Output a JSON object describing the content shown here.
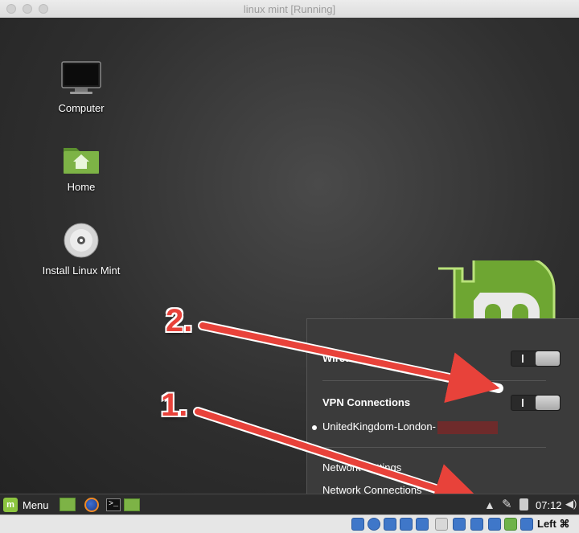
{
  "window": {
    "title": "linux mint [Running]"
  },
  "desktop": {
    "icons": [
      {
        "label": "Computer"
      },
      {
        "label": "Home"
      },
      {
        "label": "Install Linux Mint"
      }
    ]
  },
  "network_popup": {
    "wired_label": "Wired",
    "vpn_label": "VPN Connections",
    "vpn_item": "UnitedKingdom-London-",
    "network_settings": "Network Settings",
    "network_connections": "Network Connections"
  },
  "panel": {
    "menu_label": "Menu",
    "clock": "07:12"
  },
  "host_status": {
    "key_label": "Left ⌘"
  },
  "annotations": {
    "one": "1.",
    "two": "2."
  },
  "colors": {
    "annotation_red": "#e8423a",
    "mint_green": "#8cc53f"
  }
}
